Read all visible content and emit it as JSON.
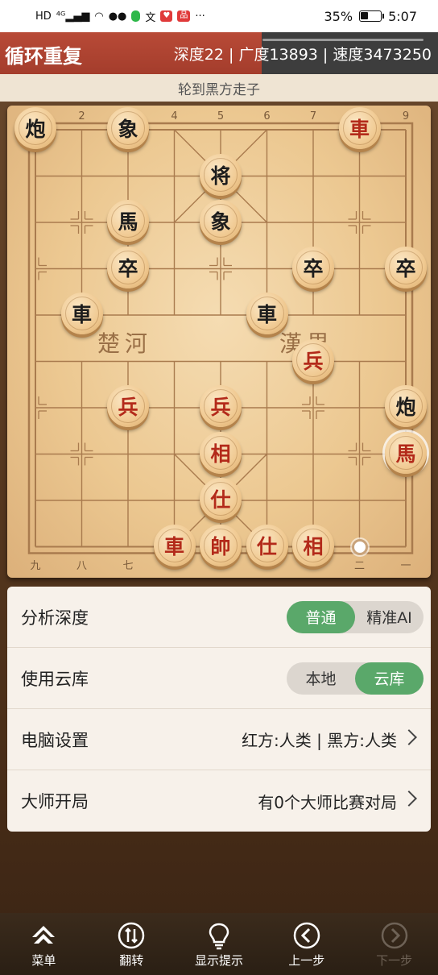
{
  "status_bar": {
    "left_icons": [
      "hd-icon",
      "signal-4g-icon",
      "wifi-icon",
      "wechat-icon",
      "green-app-icon",
      "translate-icon",
      "app-badge-icon",
      "more-icon"
    ],
    "battery_percent": "35%",
    "time": "5:07"
  },
  "header": {
    "title": "循环重复",
    "engine_info": "深度22 | 广度13893 | 速度3473250"
  },
  "turn_text": "轮到黑方走子",
  "board": {
    "file_labels_top": [
      "2",
      "4",
      "5",
      "6",
      "7",
      "9"
    ],
    "file_labels_bottom": [
      "九",
      "八",
      "七",
      "二",
      "一"
    ],
    "river_left": "楚河",
    "river_right": "漢界",
    "pieces": [
      {
        "char": "炮",
        "side": "black",
        "col": 0,
        "row": 0
      },
      {
        "char": "象",
        "side": "black",
        "col": 2,
        "row": 0
      },
      {
        "char": "車",
        "side": "red",
        "col": 7,
        "row": 0
      },
      {
        "char": "将",
        "side": "black",
        "col": 4,
        "row": 1
      },
      {
        "char": "馬",
        "side": "black",
        "col": 2,
        "row": 2
      },
      {
        "char": "象",
        "side": "black",
        "col": 4,
        "row": 2
      },
      {
        "char": "卒",
        "side": "black",
        "col": 2,
        "row": 3
      },
      {
        "char": "卒",
        "side": "black",
        "col": 6,
        "row": 3
      },
      {
        "char": "卒",
        "side": "black",
        "col": 8,
        "row": 3
      },
      {
        "char": "車",
        "side": "black",
        "col": 1,
        "row": 4
      },
      {
        "char": "車",
        "side": "black",
        "col": 5,
        "row": 4
      },
      {
        "char": "兵",
        "side": "red",
        "col": 6,
        "row": 5
      },
      {
        "char": "兵",
        "side": "red",
        "col": 2,
        "row": 6
      },
      {
        "char": "兵",
        "side": "red",
        "col": 4,
        "row": 6
      },
      {
        "char": "炮",
        "side": "black",
        "col": 8,
        "row": 6
      },
      {
        "char": "相",
        "side": "red",
        "col": 4,
        "row": 7
      },
      {
        "char": "馬",
        "side": "red",
        "col": 8,
        "row": 7,
        "selected": true
      },
      {
        "char": "仕",
        "side": "red",
        "col": 4,
        "row": 8
      },
      {
        "char": "車",
        "side": "red",
        "col": 3,
        "row": 9
      },
      {
        "char": "帥",
        "side": "red",
        "col": 4,
        "row": 9
      },
      {
        "char": "仕",
        "side": "red",
        "col": 5,
        "row": 9
      },
      {
        "char": "相",
        "side": "red",
        "col": 6,
        "row": 9
      }
    ],
    "move_marker": {
      "col": 7,
      "row": 9
    }
  },
  "settings": {
    "analysis_depth": {
      "label": "分析深度",
      "options": [
        "普通",
        "精准AI"
      ],
      "active": 0
    },
    "cloud_db": {
      "label": "使用云库",
      "options": [
        "本地",
        "云库"
      ],
      "active": 1
    },
    "computer_settings": {
      "label": "电脑设置",
      "value": "红方:人类 | 黑方:人类"
    },
    "master_opening": {
      "label": "大师开局",
      "value": "有0个大师比赛对局"
    }
  },
  "bottom_nav": [
    {
      "label": "菜单",
      "icon": "menu-icon",
      "enabled": true
    },
    {
      "label": "翻转",
      "icon": "flip-icon",
      "enabled": true
    },
    {
      "label": "显示提示",
      "icon": "hint-bulb-icon",
      "enabled": true
    },
    {
      "label": "上一步",
      "icon": "previous-icon",
      "enabled": true
    },
    {
      "label": "下一步",
      "icon": "next-icon",
      "enabled": false
    }
  ],
  "colors": {
    "title_red": "#b84a37",
    "toggle_green": "#5aa86a",
    "red_piece_text": "#b32a1a",
    "black_piece_text": "#1d1d1d"
  }
}
